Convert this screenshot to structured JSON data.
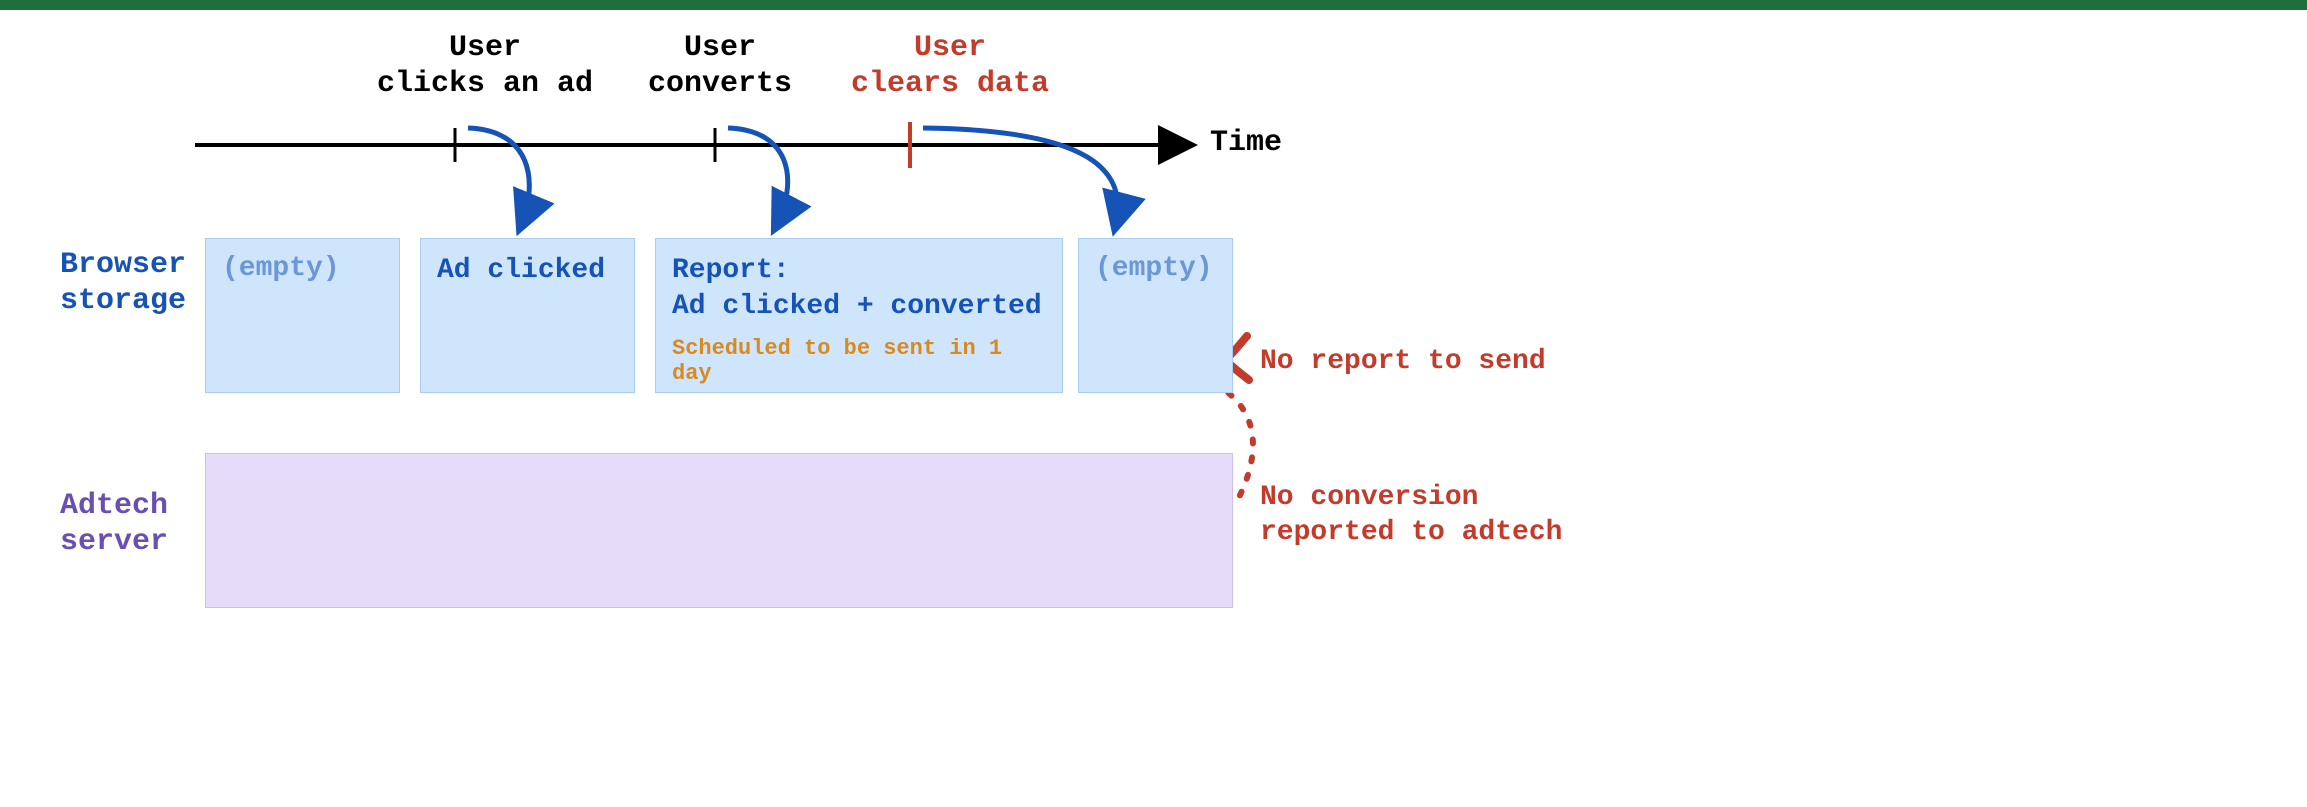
{
  "timeline": {
    "axis_label": "Time",
    "events": {
      "click": {
        "label": "User\nclicks an ad",
        "color": "#000000"
      },
      "convert": {
        "label": "User\nconverts",
        "color": "#000000"
      },
      "clear": {
        "label": "User\nclears data",
        "color": "#c33b2b"
      }
    }
  },
  "rows": {
    "browser": {
      "label": "Browser\nstorage"
    },
    "adtech": {
      "label": "Adtech\nserver"
    }
  },
  "boxes": {
    "empty1": {
      "text": "(empty)"
    },
    "adclicked": {
      "title": "Ad clicked"
    },
    "report": {
      "title": "Report:\nAd clicked + converted",
      "sub": "Scheduled to be sent in 1 day"
    },
    "empty2": {
      "text": "(empty)"
    }
  },
  "errors": {
    "no_report": "No report to send",
    "no_conv": "No conversion\nreported to adtech"
  },
  "colors": {
    "blue": "#1553b6",
    "purple": "#6a4fb3",
    "red": "#c33b2b",
    "orange": "#d88a1f",
    "box_bg": "#cfe5fb",
    "server_bg": "#e6dcf9"
  }
}
